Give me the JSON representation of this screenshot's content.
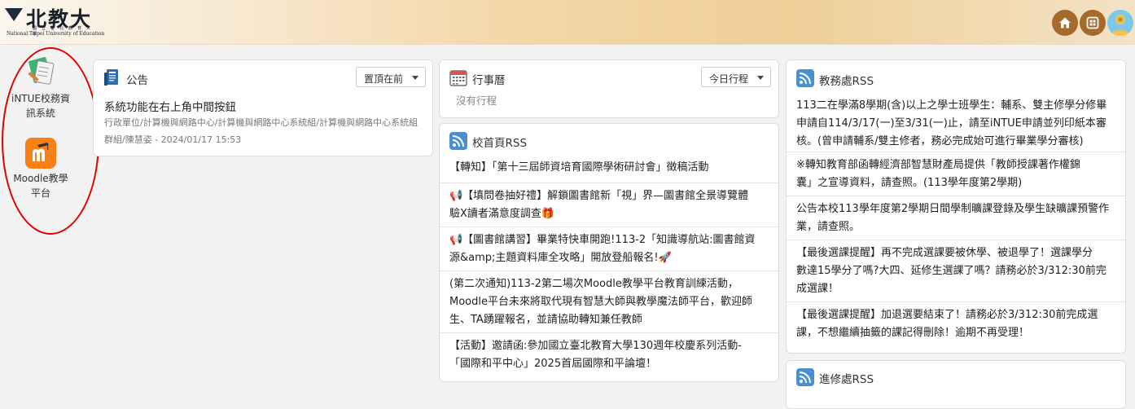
{
  "header": {
    "logo_text": "北教大",
    "logo_sub_zh": "國立臺北教育大學",
    "logo_sub_en": "National Taipei University of Education",
    "home_icon": "home-icon",
    "grid_icon": "grid-icon",
    "avatar_icon": "user-avatar-icon"
  },
  "sidebar": {
    "items": [
      {
        "label_line1": "iNTUE校務資",
        "label_line2": "訊系統",
        "icon": "books-icon"
      },
      {
        "label_line1": "Moodle教學",
        "label_line2": "平台",
        "icon": "moodle-icon"
      }
    ]
  },
  "announcement": {
    "title": "公告",
    "select_value": "置頂在前",
    "entry_title": "系統功能在右上角中間按鈕",
    "entry_meta1": "行政單位/計算機與網路中心/計算機與網路中心系統組/計算機與網路中心系統組",
    "entry_meta2": "群組/陳慧姿 - 2024/01/17 15:53"
  },
  "calendar": {
    "title": "行事曆",
    "select_value": "今日行程",
    "empty_text": "沒有行程"
  },
  "homepage_rss": {
    "title": "校首頁RSS",
    "items": [
      {
        "l1": "【轉知】「第十三屆師資培育國際學術研討會」徵稿活動",
        "l2": ""
      },
      {
        "l1": "📢【填問卷抽好禮】解鎖圖書館新「視」界—圖書館全景導覽體",
        "l2": "驗X讀者滿意度調查🎁"
      },
      {
        "l1": "📢【圖書館講習】畢業特快車開跑!113-2「知識導航站:圖書館資",
        "l2": "源&amp;主題資料庫全攻略」開放登船報名!🚀"
      },
      {
        "l1": "(第二次通知)113-2第二場次Moodle教學平台教育訓練活動，",
        "l2": "Moodle平台未來將取代現有智慧大師與教學魔法師平台，歡迎師",
        "l3": "生、TA踴躍報名，並請協助轉知兼任教師"
      },
      {
        "l1": "【活動】邀請函:參加國立臺北教育大學130週年校慶系列活動-",
        "l2": "「國際和平中心」2025首屆國際和平論壇！"
      }
    ]
  },
  "academic_rss": {
    "title": "教務處RSS",
    "items": [
      {
        "l1": "113二在學滿8學期(含)以上之學士班學生：輔系、雙主修學分修畢",
        "l2": "申請自114/3/17(一)至3/31(一)止，請至iNTUE申請並列印紙本審",
        "l3": "核。(曾申請輔系/雙主修者，務必完成始可進行畢業學分審核)"
      },
      {
        "l1": "※轉知教育部函轉經濟部智慧財產局提供「教師授課著作權錦",
        "l2": "囊」之宣導資料，請查照。(113學年度第2學期)"
      },
      {
        "l1": "公告本校113學年度第2學期日間學制曠課登錄及學生缺曠課預警作",
        "l2": "業，請查照。"
      },
      {
        "l1": "【最後選課提醒】再不完成選課要被休學、被退學了！選課學分",
        "l2": "數達15學分了嗎?大四、延修生選課了嗎？請務必於3/312:30前完",
        "l3": "成選課！"
      },
      {
        "l1": "【最後選課提醒】加退選要結束了！請務必於3/312:30前完成選",
        "l2": "課，不想繼續抽籤的課記得刪除！逾期不再受理！"
      }
    ]
  },
  "extension_rss": {
    "title": "進修處RSS"
  },
  "colors": {
    "header_button": "#a56a2c",
    "annotation_red": "#e10000",
    "rss_icon_blue": "#4a8fd0"
  }
}
